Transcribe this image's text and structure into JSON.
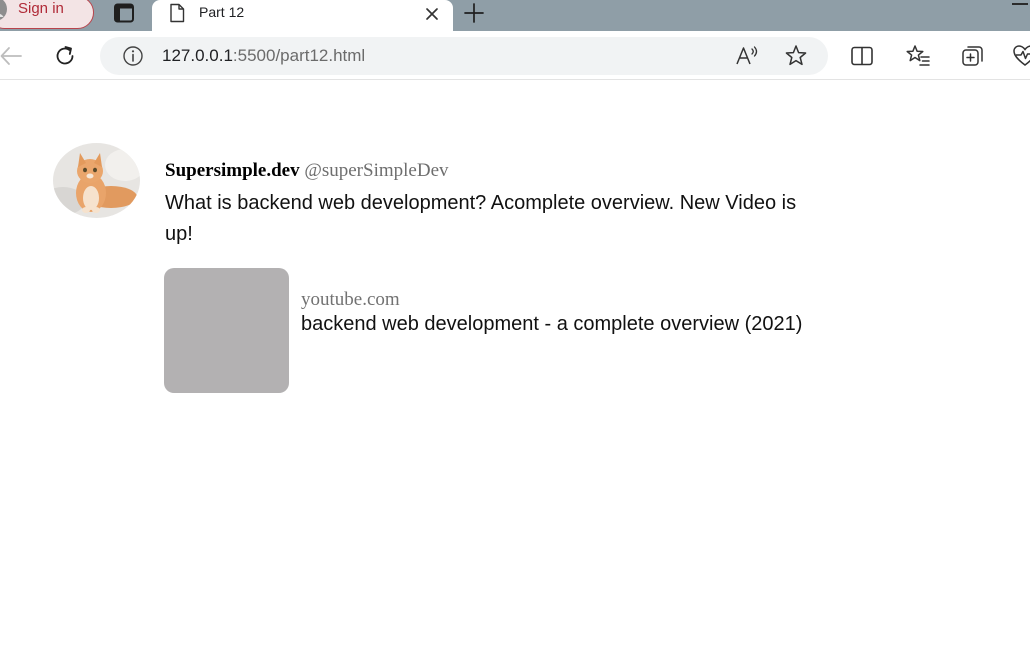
{
  "browser": {
    "profile": {
      "label": "Sign in"
    },
    "tab": {
      "title": "Part 12"
    },
    "address_bar": {
      "url_host": "127.0.0.1",
      "url_rest": ":5500/part12.html"
    },
    "icons": [
      "person-icon",
      "tab-actions-icon",
      "file-icon",
      "close-icon",
      "plus-icon",
      "back-arrow-icon",
      "refresh-icon",
      "info-icon",
      "read-aloud-icon",
      "star-icon",
      "split-screen-icon",
      "favorites-icon",
      "collections-icon",
      "heartbeat-icon"
    ],
    "colors": {
      "tab_strip": "#8f9ea7",
      "profile_accent": "#b02a37"
    }
  },
  "page": {
    "tweet": {
      "author_name": "Supersimple.dev",
      "author_handle": "@superSimpleDev",
      "text": "What is backend web development? Acomplete overview. New Video is up!",
      "link_preview": {
        "domain": "youtube.com",
        "title": "backend web development - a complete overview (2021)"
      }
    }
  }
}
